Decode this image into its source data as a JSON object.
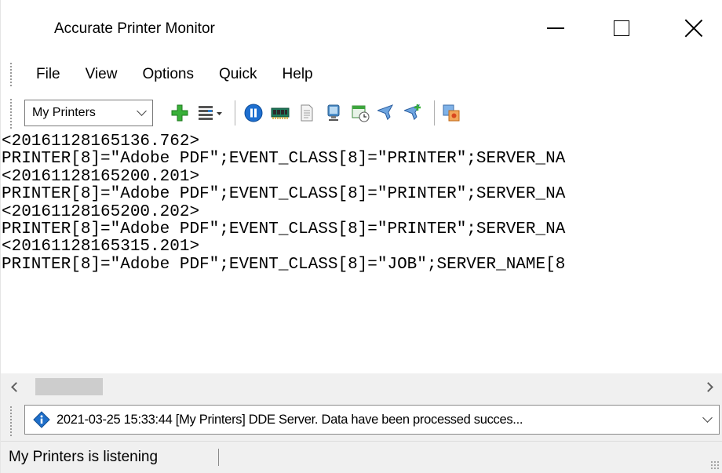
{
  "window": {
    "title": "Accurate Printer Monitor"
  },
  "menu": {
    "items": [
      "File",
      "View",
      "Options",
      "Quick",
      "Help"
    ]
  },
  "toolbar": {
    "printer_group": "My Printers",
    "icons": [
      "add-icon",
      "list-icon",
      "pause-icon",
      "memory-icon",
      "document-icon",
      "display-icon",
      "schedule-icon",
      "filter-icon",
      "filter-plus-icon",
      "export-icon"
    ]
  },
  "log": {
    "lines": [
      "<20161128165136.762>",
      "PRINTER[8]=\"Adobe PDF\";EVENT_CLASS[8]=\"PRINTER\";SERVER_NA",
      "<20161128165200.201>",
      "PRINTER[8]=\"Adobe PDF\";EVENT_CLASS[8]=\"PRINTER\";SERVER_NA",
      "<20161128165200.202>",
      "PRINTER[8]=\"Adobe PDF\";EVENT_CLASS[8]=\"PRINTER\";SERVER_NA",
      "<20161128165315.201>",
      "PRINTER[8]=\"Adobe PDF\";EVENT_CLASS[8]=\"JOB\";SERVER_NAME[8"
    ]
  },
  "status_combo": {
    "message": "2021-03-25 15:33:44 [My Printers] DDE Server. Data have been processed succes..."
  },
  "statusbar": {
    "text": "My Printers is listening"
  },
  "colors": {
    "green": "#2e9e2e",
    "blue": "#1565c0",
    "chrome": "#f0f0f0"
  }
}
